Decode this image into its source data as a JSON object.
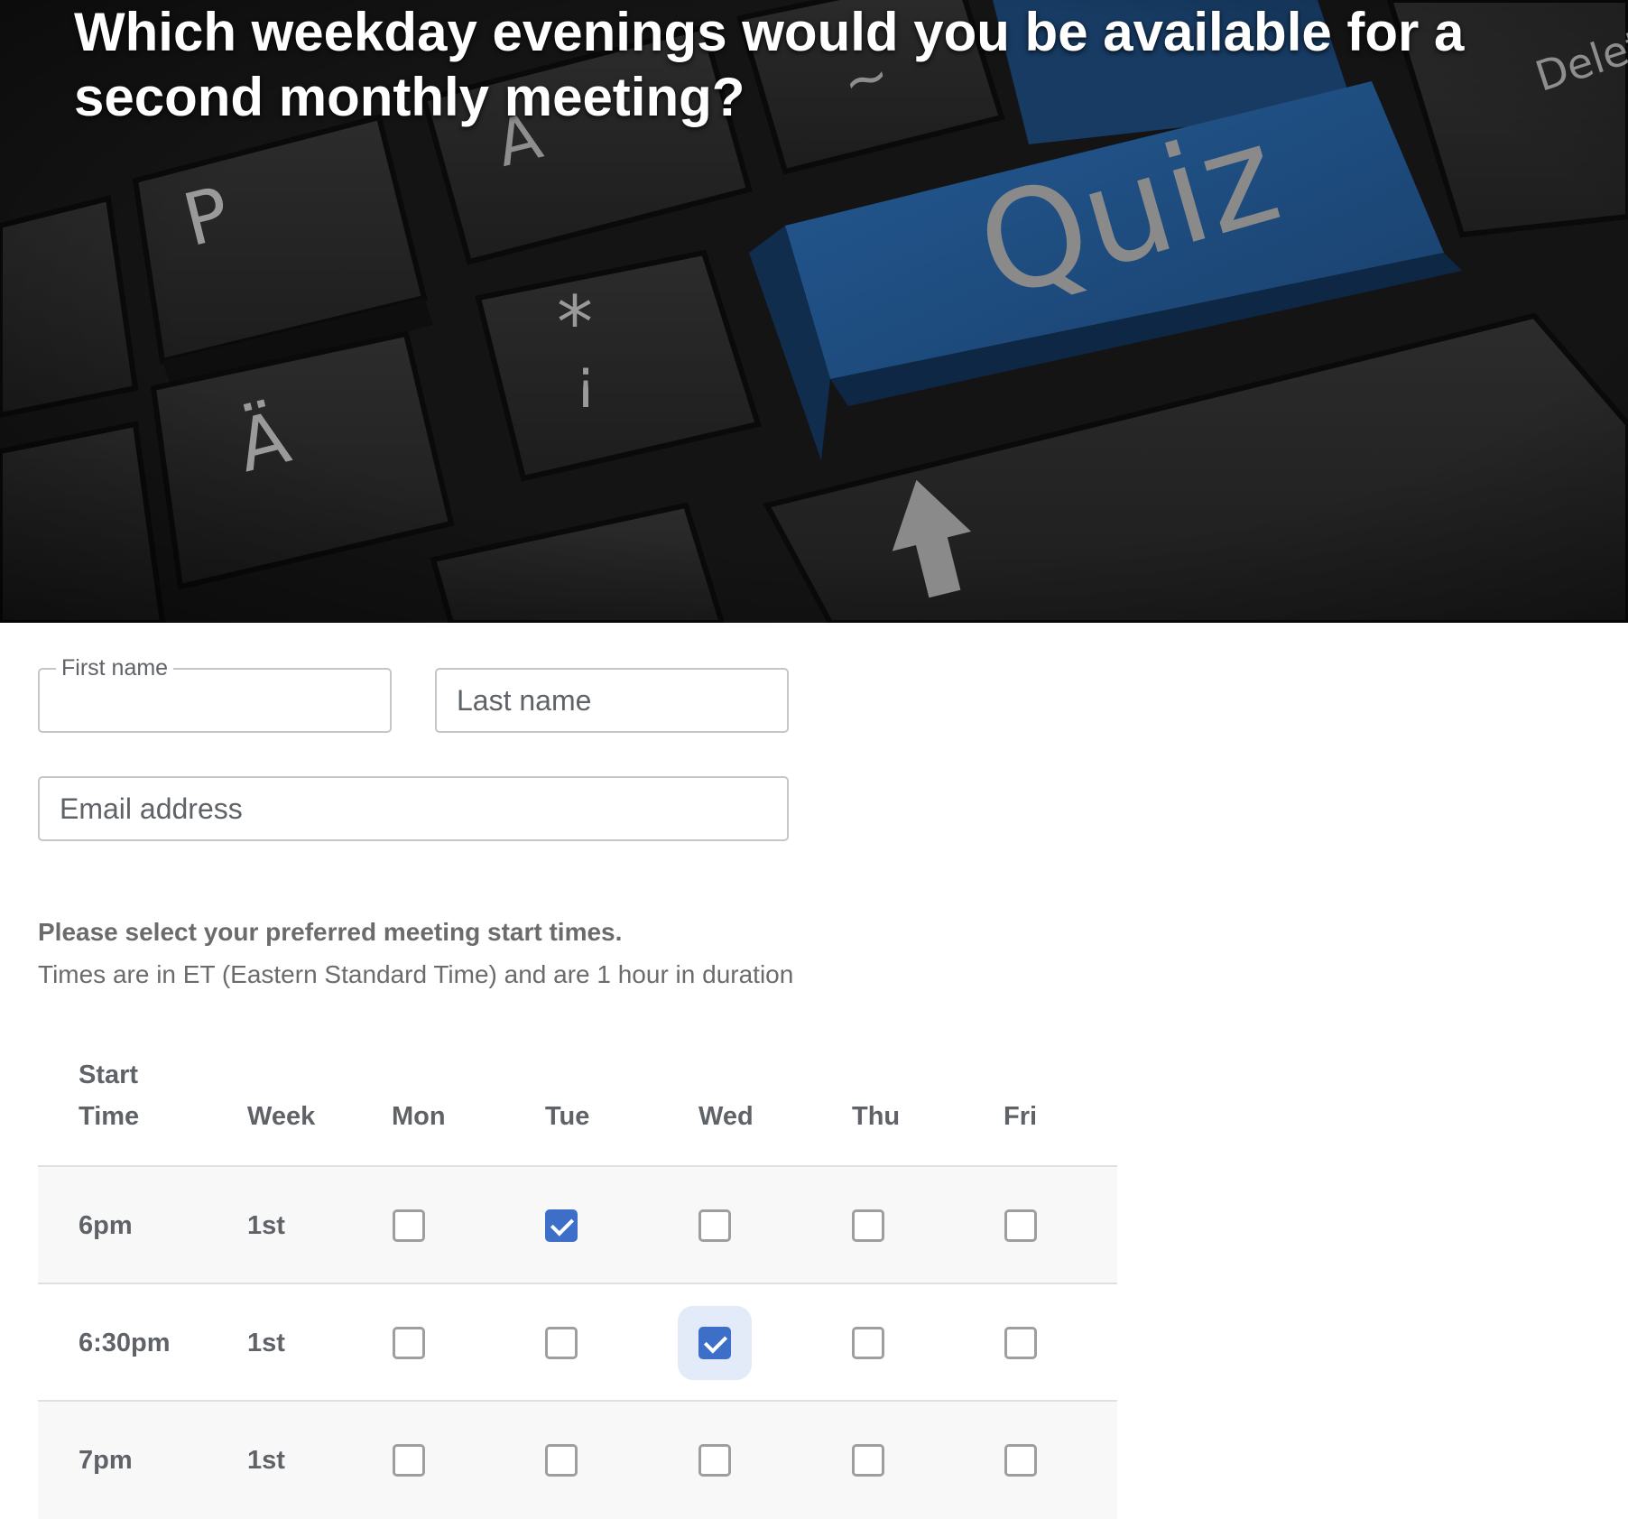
{
  "hero": {
    "title": "Which weekday evenings would you be available for a second monthly meeting?",
    "keys": {
      "p": "P",
      "a_umlaut": "Ä",
      "a_upper": "A",
      "asterisk": "*",
      "small_i": "¡",
      "tilde": "~",
      "quiz": "Quiz",
      "delete": "Delet"
    }
  },
  "form": {
    "first_name_label": "First name",
    "first_name_value": "",
    "last_name_placeholder": "Last name",
    "email_placeholder": "Email address"
  },
  "instructions": {
    "title": "Please select your preferred meeting start times.",
    "subtitle": "Times are in ET (Eastern Standard Time) and are 1 hour in duration"
  },
  "table": {
    "headers": {
      "start_time_line1": "Start",
      "start_time_line2": "Time",
      "week": "Week",
      "mon": "Mon",
      "tue": "Tue",
      "wed": "Wed",
      "thu": "Thu",
      "fri": "Fri"
    },
    "rows": [
      {
        "time": "6pm",
        "week": "1st",
        "checked": [
          false,
          true,
          false,
          false,
          false
        ]
      },
      {
        "time": "6:30pm",
        "week": "1st",
        "checked": [
          false,
          false,
          true,
          false,
          false
        ]
      },
      {
        "time": "7pm",
        "week": "1st",
        "checked": [
          false,
          false,
          false,
          false,
          false
        ]
      }
    ]
  },
  "colors": {
    "checkbox_checked": "#3d6fc9",
    "quiz_key": "#1e4f86"
  }
}
